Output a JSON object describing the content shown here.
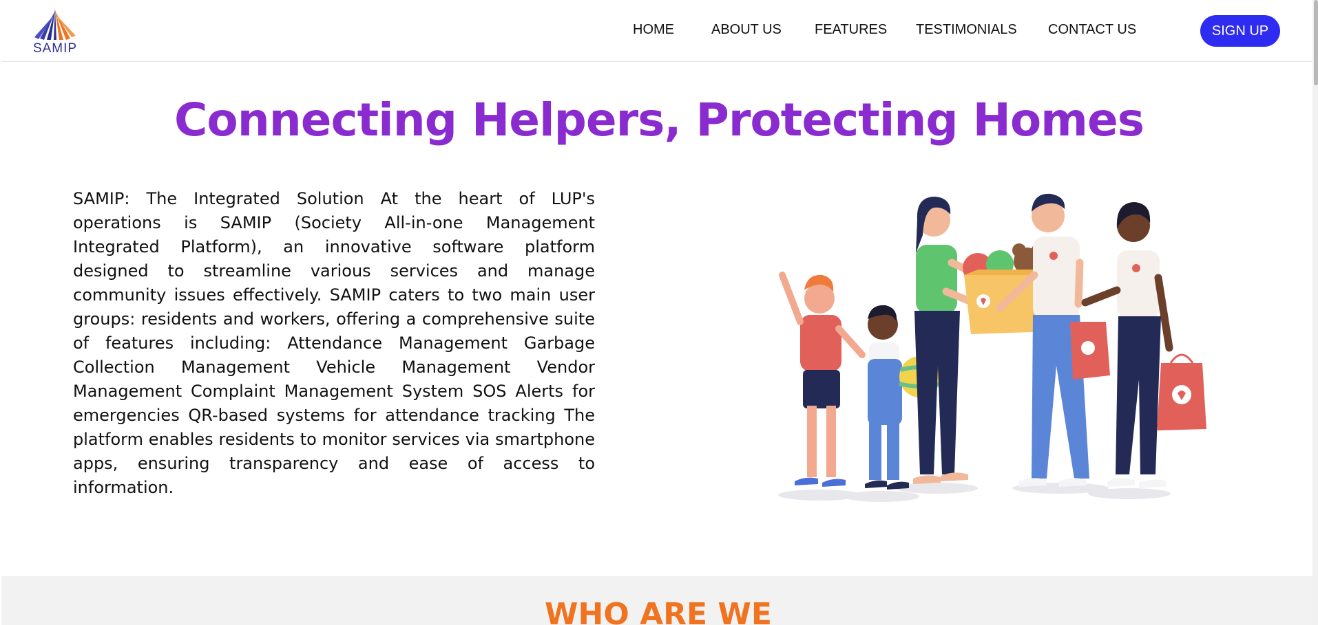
{
  "brand": {
    "name": "SAMIP"
  },
  "nav": {
    "home": "HOME",
    "about": "ABOUT US",
    "features": "FEATURES",
    "testimonials": "TESTIMONIALS",
    "contact": "CONTACT US",
    "signup": "SIGN UP"
  },
  "hero": {
    "title": "Connecting Helpers, Protecting Homes",
    "body": "SAMIP: The Integrated Solution At the heart of LUP's operations is SAMIP (Society All-in-one Management Integrated Platform), an innovative software platform designed to streamline various services and manage community issues effectively. SAMIP caters to two main user groups: residents and workers, offering a comprehensive suite of features including: Attendance Management Garbage Collection Management Vehicle Management Vendor Management Complaint Management System SOS Alerts for emergencies QR-based systems for attendance tracking The platform enables residents to monitor services via smartphone apps, ensuring transparency and ease of access to information."
  },
  "who": {
    "title": "WHO ARE WE"
  },
  "colors": {
    "accent_purple": "#8a2bd0",
    "button_blue": "#2f2cf2",
    "section_orange": "#f07320",
    "section_bg": "#f2f2f2"
  }
}
